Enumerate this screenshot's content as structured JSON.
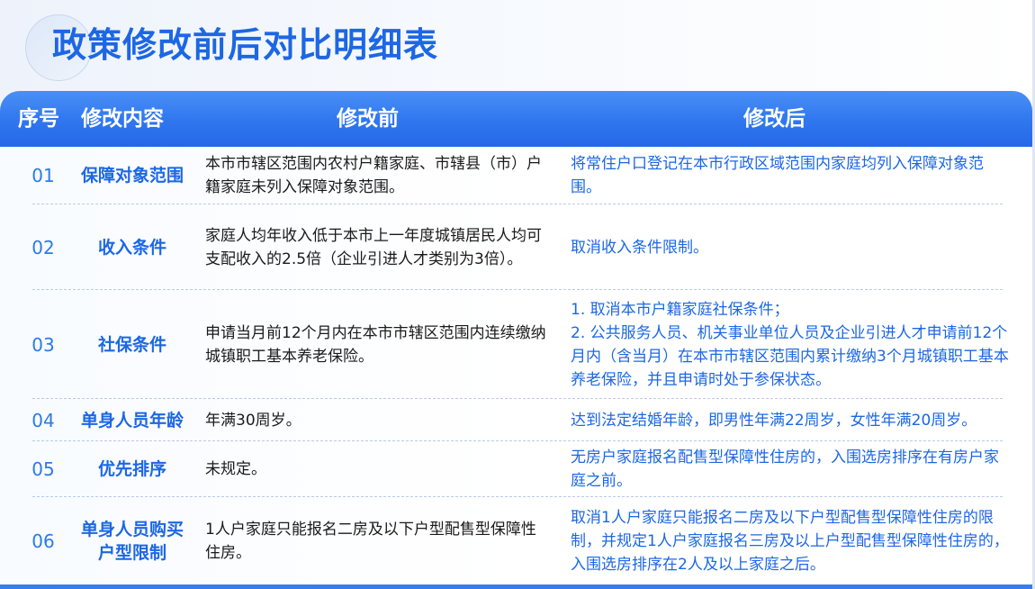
{
  "title": "政策修改前后对比明细表",
  "headers": {
    "index": "序号",
    "item": "修改内容",
    "before": "修改前",
    "after": "修改后"
  },
  "rows": [
    {
      "index": "01",
      "item": "保障对象范围",
      "before": "本市市辖区范围内农村户籍家庭、市辖县（市）户籍家庭未列入保障对象范围。",
      "after": "将常住户口登记在本市行政区域范围内家庭均列入保障对象范围。"
    },
    {
      "index": "02",
      "item": "收入条件",
      "before": "家庭人均年收入低于本市上一年度城镇居民人均可支配收入的2.5倍（企业引进人才类别为3倍）。",
      "after": "取消收入条件限制。"
    },
    {
      "index": "03",
      "item": "社保条件",
      "before": "申请当月前12个月内在本市市辖区范围内连续缴纳城镇职工基本养老保险。",
      "after": "1. 取消本市户籍家庭社保条件；\n2. 公共服务人员、机关事业单位人员及企业引进人才申请前12个月内（含当月）在本市市辖区范围内累计缴纳3个月城镇职工基本养老保险，并且申请时处于参保状态。"
    },
    {
      "index": "04",
      "item": "单身人员年龄",
      "before": "年满30周岁。",
      "after": "达到法定结婚年龄，即男性年满22周岁，女性年满20周岁。"
    },
    {
      "index": "05",
      "item": "优先排序",
      "before": "未规定。",
      "after": "无房户家庭报名配售型保障性住房的，入围选房排序在有房户家庭之前。"
    },
    {
      "index": "06",
      "item": "单身人员购买户型限制",
      "before": "1人户家庭只能报名二房及以下户型配售型保障性住房。",
      "after": "取消1人户家庭只能报名二房及以下户型配售型保障性住房的限制，并规定1人户家庭报名三房及以上户型配售型保障性住房的，入围选房排序在2人及以上家庭之后。"
    }
  ],
  "colors": {
    "accent": "#1c67e4",
    "header_bg": "#2f76ef",
    "text": "#1a1a1a"
  }
}
